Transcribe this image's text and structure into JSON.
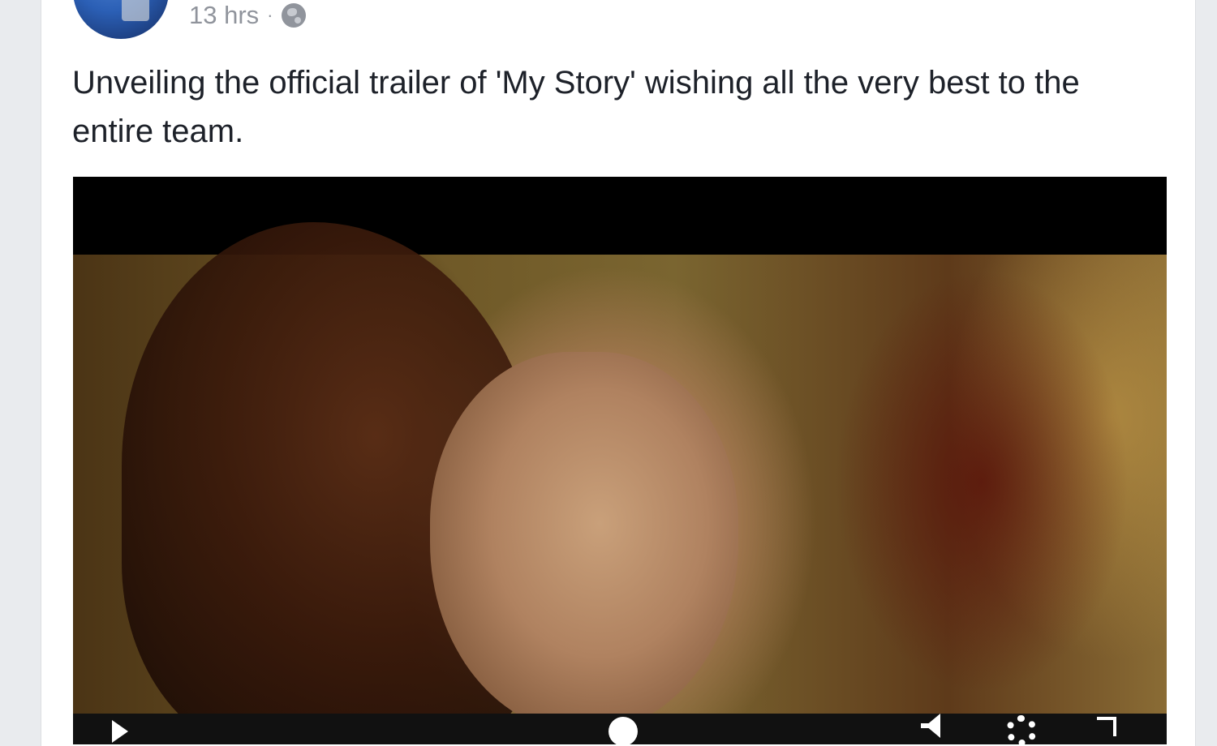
{
  "post": {
    "timestamp": "13 hrs",
    "separator": "·",
    "privacy_icon": "globe-icon",
    "text": "Unveiling the official trailer of 'My Story' wishing all the very best to the entire team."
  },
  "video": {
    "controls": {
      "play_icon": "play-icon",
      "scrubber_icon": "scrubber-icon",
      "volume_icon": "volume-icon",
      "settings_icon": "settings-icon",
      "fullscreen_icon": "fullscreen-icon"
    }
  },
  "colors": {
    "page_background": "#e9ebee",
    "card_background": "#ffffff",
    "meta_text": "#90949c",
    "body_text": "#1d2129"
  }
}
